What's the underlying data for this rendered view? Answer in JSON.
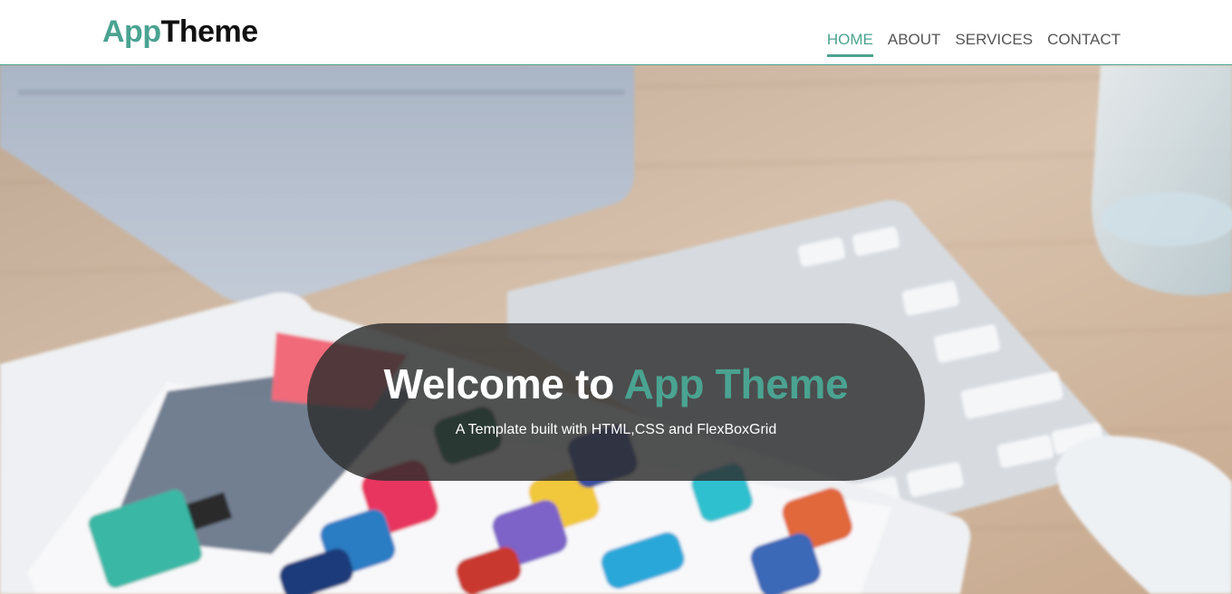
{
  "header": {
    "logo": {
      "part1": "App",
      "part2": "Theme"
    },
    "nav": [
      {
        "label": "HOME",
        "active": true
      },
      {
        "label": "ABOUT",
        "active": false
      },
      {
        "label": "SERVICES",
        "active": false
      },
      {
        "label": "CONTACT",
        "active": false
      }
    ]
  },
  "hero": {
    "title_prefix": "Welcome to ",
    "title_accent": "App Theme",
    "subtitle": "A Template built with HTML,CSS and FlexBoxGrid"
  },
  "colors": {
    "accent": "#4aa391",
    "overlay": "rgba(45,45,45,0.82)",
    "nav_text": "#555555"
  }
}
